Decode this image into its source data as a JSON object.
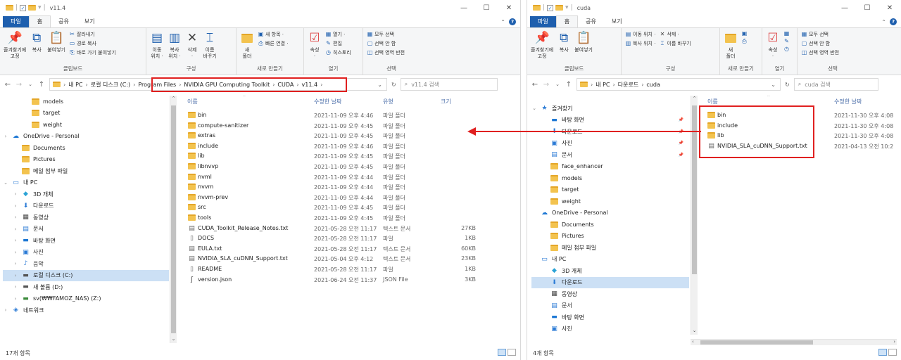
{
  "window1": {
    "title": "v11.4",
    "tabs": [
      "파일",
      "홈",
      "공유",
      "보기"
    ],
    "ribbon": {
      "clipboard": {
        "title": "클립보드",
        "pin": "즐겨찾기에\n고정",
        "copy": "복사",
        "paste": "붙여넣기",
        "cut": "잘라내기",
        "copy_path": "경로 복사",
        "paste_shortcut": "바로 가기 붙여넣기"
      },
      "organize": {
        "title": "구성",
        "move_to": "이동\n위치 ·",
        "copy_to": "복사\n위치 ·",
        "delete": "삭제\n·",
        "rename": "이름\n바꾸기"
      },
      "new": {
        "title": "새로 만들기",
        "new_folder": "새\n폴더",
        "new_item": "새 항목 ·",
        "easy_access": "빠른 연결 ·"
      },
      "open": {
        "title": "열기",
        "properties": "속성\n·",
        "open": "열기 ·",
        "edit": "편집",
        "history": "히스토리"
      },
      "select": {
        "title": "선택",
        "select_all": "모두 선택",
        "select_none": "선택 안 함",
        "invert": "선택 영역 반전"
      }
    },
    "address": [
      "Program Files",
      "NVIDIA GPU Computing Toolkit",
      "CUDA",
      "v11.4"
    ],
    "address_prefix": [
      "내 PC",
      "로컬 디스크 (C:)"
    ],
    "search_placeholder": "v11.4 검색",
    "nav": [
      {
        "label": "models",
        "icon": "folder-icon",
        "indent": 2
      },
      {
        "label": "target",
        "icon": "folder-icon",
        "indent": 2
      },
      {
        "label": "weight",
        "icon": "folder-icon",
        "indent": 2
      },
      {
        "label": "OneDrive - Personal",
        "icon": "cloud-icon",
        "indent": 0,
        "exp": "›"
      },
      {
        "label": "Documents",
        "icon": "folder-icon",
        "indent": 1
      },
      {
        "label": "Pictures",
        "icon": "folder-icon",
        "indent": 1
      },
      {
        "label": "메일 첨부 파일",
        "icon": "folder-icon",
        "indent": 1
      },
      {
        "label": "내 PC",
        "icon": "pc-icon",
        "indent": 0,
        "exp": "⌄"
      },
      {
        "label": "3D 개체",
        "icon": "cube-icon",
        "indent": 1,
        "exp": "›"
      },
      {
        "label": "다운로드",
        "icon": "download-icon",
        "indent": 1,
        "exp": "›"
      },
      {
        "label": "동영상",
        "icon": "video-icon",
        "indent": 1,
        "exp": "›"
      },
      {
        "label": "문서",
        "icon": "document-icon",
        "indent": 1,
        "exp": "›"
      },
      {
        "label": "바탕 화면",
        "icon": "desktop-icon",
        "indent": 1,
        "exp": "›"
      },
      {
        "label": "사진",
        "icon": "picture-icon",
        "indent": 1,
        "exp": "›"
      },
      {
        "label": "음악",
        "icon": "music-icon",
        "indent": 1,
        "exp": "›"
      },
      {
        "label": "로컬 디스크 (C:)",
        "icon": "drive-icon",
        "indent": 1,
        "exp": "›",
        "selected": true
      },
      {
        "label": "새 볼륨 (D:)",
        "icon": "drive-icon",
        "indent": 1,
        "exp": "›"
      },
      {
        "label": "sv(₩₩FAMOZ_NAS) (Z:)",
        "icon": "network-drive-icon",
        "indent": 1,
        "exp": "›"
      },
      {
        "label": "네트워크",
        "icon": "network-icon",
        "indent": 0,
        "exp": "›"
      }
    ],
    "columns": {
      "name": "이름",
      "date": "수정한 날짜",
      "type": "유형",
      "size": "크기"
    },
    "files": [
      {
        "name": "bin",
        "date": "2021-11-09 오후 4:46",
        "type": "파일 폴더",
        "size": "",
        "icon": "folder-icon"
      },
      {
        "name": "compute-sanitizer",
        "date": "2021-11-09 오후 4:45",
        "type": "파일 폴더",
        "size": "",
        "icon": "folder-icon"
      },
      {
        "name": "extras",
        "date": "2021-11-09 오후 4:45",
        "type": "파일 폴더",
        "size": "",
        "icon": "folder-icon"
      },
      {
        "name": "include",
        "date": "2021-11-09 오후 4:46",
        "type": "파일 폴더",
        "size": "",
        "icon": "folder-icon"
      },
      {
        "name": "lib",
        "date": "2021-11-09 오후 4:45",
        "type": "파일 폴더",
        "size": "",
        "icon": "folder-icon"
      },
      {
        "name": "libnvvp",
        "date": "2021-11-09 오후 4:45",
        "type": "파일 폴더",
        "size": "",
        "icon": "folder-icon"
      },
      {
        "name": "nvml",
        "date": "2021-11-09 오후 4:44",
        "type": "파일 폴더",
        "size": "",
        "icon": "folder-icon"
      },
      {
        "name": "nvvm",
        "date": "2021-11-09 오후 4:44",
        "type": "파일 폴더",
        "size": "",
        "icon": "folder-icon"
      },
      {
        "name": "nvvm-prev",
        "date": "2021-11-09 오후 4:44",
        "type": "파일 폴더",
        "size": "",
        "icon": "folder-icon"
      },
      {
        "name": "src",
        "date": "2021-11-09 오후 4:45",
        "type": "파일 폴더",
        "size": "",
        "icon": "folder-icon"
      },
      {
        "name": "tools",
        "date": "2021-11-09 오후 4:45",
        "type": "파일 폴더",
        "size": "",
        "icon": "folder-icon"
      },
      {
        "name": "CUDA_Toolkit_Release_Notes.txt",
        "date": "2021-05-28 오전 11:17",
        "type": "텍스트 문서",
        "size": "27KB",
        "icon": "text-file-icon"
      },
      {
        "name": "DOCS",
        "date": "2021-05-28 오전 11:17",
        "type": "파일",
        "size": "1KB",
        "icon": "file-icon"
      },
      {
        "name": "EULA.txt",
        "date": "2021-05-28 오전 11:17",
        "type": "텍스트 문서",
        "size": "60KB",
        "icon": "text-file-icon"
      },
      {
        "name": "NVIDIA_SLA_cuDNN_Support.txt",
        "date": "2021-05-04 오후 4:12",
        "type": "텍스트 문서",
        "size": "23KB",
        "icon": "text-file-icon"
      },
      {
        "name": "README",
        "date": "2021-05-28 오전 11:17",
        "type": "파일",
        "size": "1KB",
        "icon": "file-icon"
      },
      {
        "name": "version.json",
        "date": "2021-06-24 오전 11:37",
        "type": "JSON File",
        "size": "3KB",
        "icon": "json-file-icon"
      }
    ],
    "status": "17개 항목"
  },
  "window2": {
    "title": "cuda",
    "tabs": [
      "파일",
      "홈",
      "공유",
      "보기"
    ],
    "ribbon": {
      "clipboard": {
        "title": "클립보드",
        "pin": "즐겨찾기에\n고정",
        "copy": "복사",
        "paste": "붙여넣기"
      },
      "organize": {
        "title": "구성",
        "move_to": "이동 위치 ·",
        "copy_to": "복사 위치 ·",
        "delete": "삭제 ·",
        "rename": "이름 바꾸기"
      },
      "new": {
        "title": "새로 만들기",
        "new_folder": "새\n폴더"
      },
      "open": {
        "title": "열기",
        "properties": "속성\n·"
      },
      "select": {
        "title": "선택",
        "select_all": "모두 선택",
        "select_none": "선택 안 함",
        "invert": "선택 영역 반전"
      }
    },
    "address": [
      "내 PC",
      "다운로드",
      "cuda"
    ],
    "search_placeholder": "cuda 검색",
    "nav": [
      {
        "label": "즐겨찾기",
        "icon": "star-icon",
        "indent": 0,
        "exp": "⌄"
      },
      {
        "label": "바탕 화면",
        "icon": "desktop-icon",
        "indent": 1,
        "pin": true
      },
      {
        "label": "다운로드",
        "icon": "download-icon",
        "indent": 1,
        "pin": true
      },
      {
        "label": "사진",
        "icon": "picture-icon",
        "indent": 1,
        "pin": true
      },
      {
        "label": "문서",
        "icon": "document-icon",
        "indent": 1,
        "pin": true
      },
      {
        "label": "face_enhancer",
        "icon": "folder-icon",
        "indent": 1
      },
      {
        "label": "models",
        "icon": "folder-icon",
        "indent": 1
      },
      {
        "label": "target",
        "icon": "folder-icon",
        "indent": 1
      },
      {
        "label": "weight",
        "icon": "folder-icon",
        "indent": 1
      },
      {
        "label": "OneDrive - Personal",
        "icon": "cloud-icon",
        "indent": 0
      },
      {
        "label": "Documents",
        "icon": "folder-icon",
        "indent": 1
      },
      {
        "label": "Pictures",
        "icon": "folder-icon",
        "indent": 1
      },
      {
        "label": "메일 첨부 파일",
        "icon": "folder-icon",
        "indent": 1
      },
      {
        "label": "내 PC",
        "icon": "pc-icon",
        "indent": 0
      },
      {
        "label": "3D 개체",
        "icon": "cube-icon",
        "indent": 1
      },
      {
        "label": "다운로드",
        "icon": "download-icon",
        "indent": 1,
        "selected": true
      },
      {
        "label": "동영상",
        "icon": "video-icon",
        "indent": 1
      },
      {
        "label": "문서",
        "icon": "document-icon",
        "indent": 1
      },
      {
        "label": "바탕 화면",
        "icon": "desktop-icon",
        "indent": 1
      },
      {
        "label": "사진",
        "icon": "picture-icon",
        "indent": 1
      }
    ],
    "columns": {
      "name": "이름",
      "date": "수정한 날짜"
    },
    "files": [
      {
        "name": "bin",
        "date": "2021-11-30 오후 4:08",
        "icon": "folder-icon"
      },
      {
        "name": "include",
        "date": "2021-11-30 오후 4:08",
        "icon": "folder-icon"
      },
      {
        "name": "lib",
        "date": "2021-11-30 오후 4:08",
        "icon": "folder-icon"
      },
      {
        "name": "NVIDIA_SLA_cuDNN_Support.txt",
        "date": "2021-04-13 오전 10:2",
        "icon": "text-file-icon"
      }
    ],
    "status": "4개 항목"
  },
  "annotation": {
    "color": "#e02020"
  }
}
